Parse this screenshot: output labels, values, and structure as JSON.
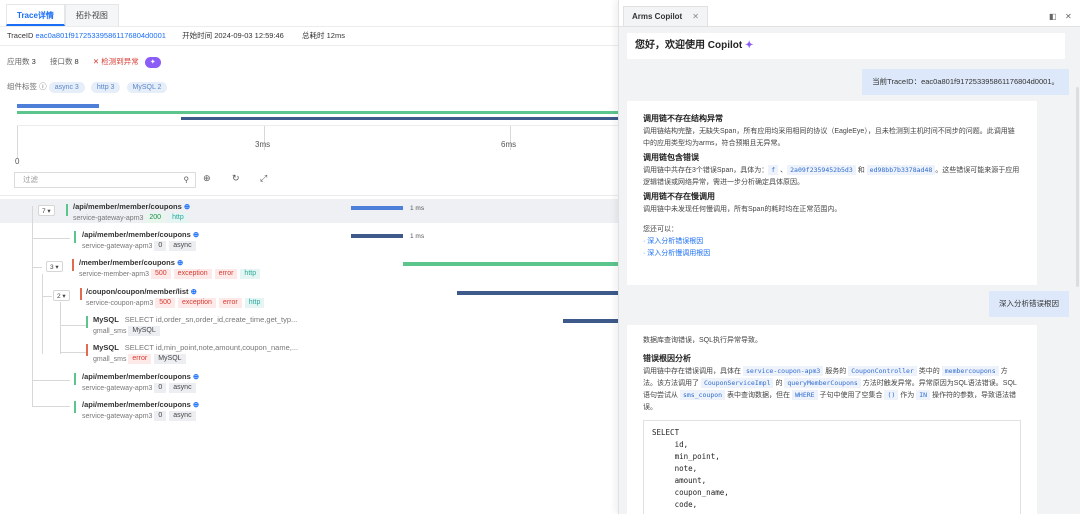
{
  "tabs": {
    "trace": "Trace详情",
    "topology": "拓扑视图"
  },
  "info": {
    "traceid_label": "TraceID",
    "traceid_value": "eac0a801f917253395861176804d0001",
    "start_label": "开始时间",
    "start_value": "2024-09-03 12:59:46",
    "total_label": "总耗时",
    "total_value": "12ms"
  },
  "stats": {
    "apps_label": "应用数",
    "apps_value": "3",
    "ports_label": "接口数",
    "ports_value": "8",
    "anomaly_label": "检测到异常"
  },
  "components": {
    "label": "组件标签",
    "chips": [
      "async 3",
      "http 3",
      "MySQL 2"
    ]
  },
  "timeline": {
    "ticks": [
      "0",
      "3ms",
      "6ms"
    ]
  },
  "filter": {
    "placeholder": "过滤"
  },
  "spans": [
    {
      "count": "7",
      "name": "/api/member/member/coupons",
      "service": "service-gateway-apm3",
      "tags": [
        "200",
        "http"
      ],
      "duration": "1 ms"
    },
    {
      "count": "",
      "name": "/api/member/member/coupons",
      "service": "service-gateway-apm3",
      "tags": [
        "0",
        "async"
      ],
      "duration": "1 ms"
    },
    {
      "count": "3",
      "name": "/member/member/coupons",
      "service": "service-member-apm3",
      "tags": [
        "500",
        "exception",
        "error",
        "http"
      ],
      "duration": ""
    },
    {
      "count": "2",
      "name": "/coupon/coupon/member/list",
      "service": "service-coupon-apm3",
      "tags": [
        "500",
        "exception",
        "error",
        "http"
      ],
      "duration": ""
    },
    {
      "count": "",
      "name": "MySQL",
      "sql": "SELECT id,order_sn,order_id,create_time,get_typ...",
      "service": "gmall_sms",
      "tags": [
        "MySQL"
      ],
      "duration": ""
    },
    {
      "count": "",
      "name": "MySQL",
      "sql": "SELECT id,min_point,note,amount,coupon_name,...",
      "service": "gmall_sms",
      "tags": [
        "error",
        "MySQL"
      ],
      "duration": ""
    },
    {
      "count": "",
      "name": "/api/member/member/coupons",
      "service": "service-gateway-apm3",
      "tags": [
        "0",
        "async"
      ],
      "duration": ""
    },
    {
      "count": "",
      "name": "/api/member/member/coupons",
      "service": "service-gateway-apm3",
      "tags": [
        "0",
        "async"
      ],
      "duration": ""
    }
  ],
  "copilot": {
    "tab_title": "Arms Copilot",
    "welcome": "您好，欢迎使用 Copilot",
    "user_msg1": "当前TraceID：eac0a801f917253395861176804d0001。",
    "card1": {
      "h1": "调用链不存在结构异常",
      "p1": "调用链结构完整，无缺失Span，所有应用均采用相同的协议（EagleEye），且未检测到主机时间不同步的问题。此调用链中的应用类型均为arms，符合预期且无异常。",
      "h2": "调用链包含错误",
      "p2_pre": "调用链中共存在3个错误Span，具体为：",
      "code_f": "f",
      "code_a": "2a09f2359452b5d3",
      "p2_and": "和",
      "code_b": "ed98bb7b3378ad48",
      "p2_post": "。这些错误可能来源于应用逻辑错误或网络异常，需进一步分析确定具体原因。",
      "h3": "调用链不存在慢调用",
      "p3": "调用链中未发现任何慢调用，所有Span的耗时均在正常范围内。",
      "you_can": "您还可以：",
      "link1": "深入分析错误根因",
      "link2": "深入分析慢调用根因"
    },
    "user_msg2": "深入分析错误根因",
    "card2": {
      "intro": "数据库查询错误，SQL执行异常导致。",
      "h1": "错误根因分析",
      "p_a": "调用链中存在错误调用，具体在",
      "code1": "service-coupon-apm3",
      "p_b": "服务的",
      "code2": "CouponController",
      "p_c": "类中的",
      "code3": "membercoupons",
      "p_d": "方法。该方法调用了",
      "code4": "CouponServiceImpl",
      "p_e": "的",
      "code5": "queryMemberCoupons",
      "p_f": "方法时触发异常。异常原因为SQL语法错误。SQL语句尝试从",
      "code6": "sms_coupon",
      "p_g": "表中查询数据，但在",
      "code7": "WHERE",
      "p_h": "子句中使用了空集合",
      "code8": "()",
      "p_i": "作为",
      "code9": "IN",
      "p_j": "操作符的参数，导致语法错误。",
      "sql": "SELECT\n     id,\n     min_point,\n     note,\n     amount,\n     coupon_name,\n     code,"
    }
  },
  "colors": {
    "accent": "#1a6ef5",
    "green": "#5bc58c",
    "darkblue": "#3d5a8a",
    "red": "#e06b4f"
  }
}
